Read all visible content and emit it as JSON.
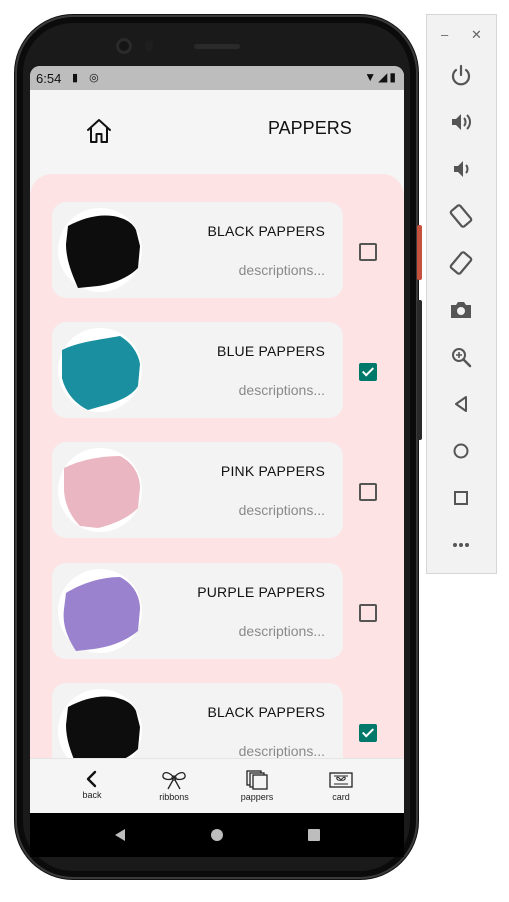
{
  "status_bar": {
    "time": "6:54"
  },
  "app_bar": {
    "title": "PAPPERS"
  },
  "items": [
    {
      "name": "BLACK PAPPERS",
      "description": "descriptions...",
      "checked": false,
      "color": "#0d0d0d"
    },
    {
      "name": "BLUE PAPPERS",
      "description": "descriptions...",
      "checked": true,
      "color": "#1a8fa0"
    },
    {
      "name": "PINK PAPPERS",
      "description": "descriptions...",
      "checked": false,
      "color": "#eab6c2"
    },
    {
      "name": "PURPLE PAPPERS",
      "description": "descriptions...",
      "checked": false,
      "color": "#9b82cf"
    },
    {
      "name": "BLACK PAPPERS",
      "description": "descriptions...",
      "checked": true,
      "color": "#0d0d0d"
    }
  ],
  "bottom_nav": {
    "back": "back",
    "ribbons": "ribbons",
    "pappers": "pappers",
    "card": "card"
  },
  "colors": {
    "panel_background": "#fde3e3",
    "checkbox_checked": "#00796b",
    "screen_background": "#f5f5f5"
  }
}
